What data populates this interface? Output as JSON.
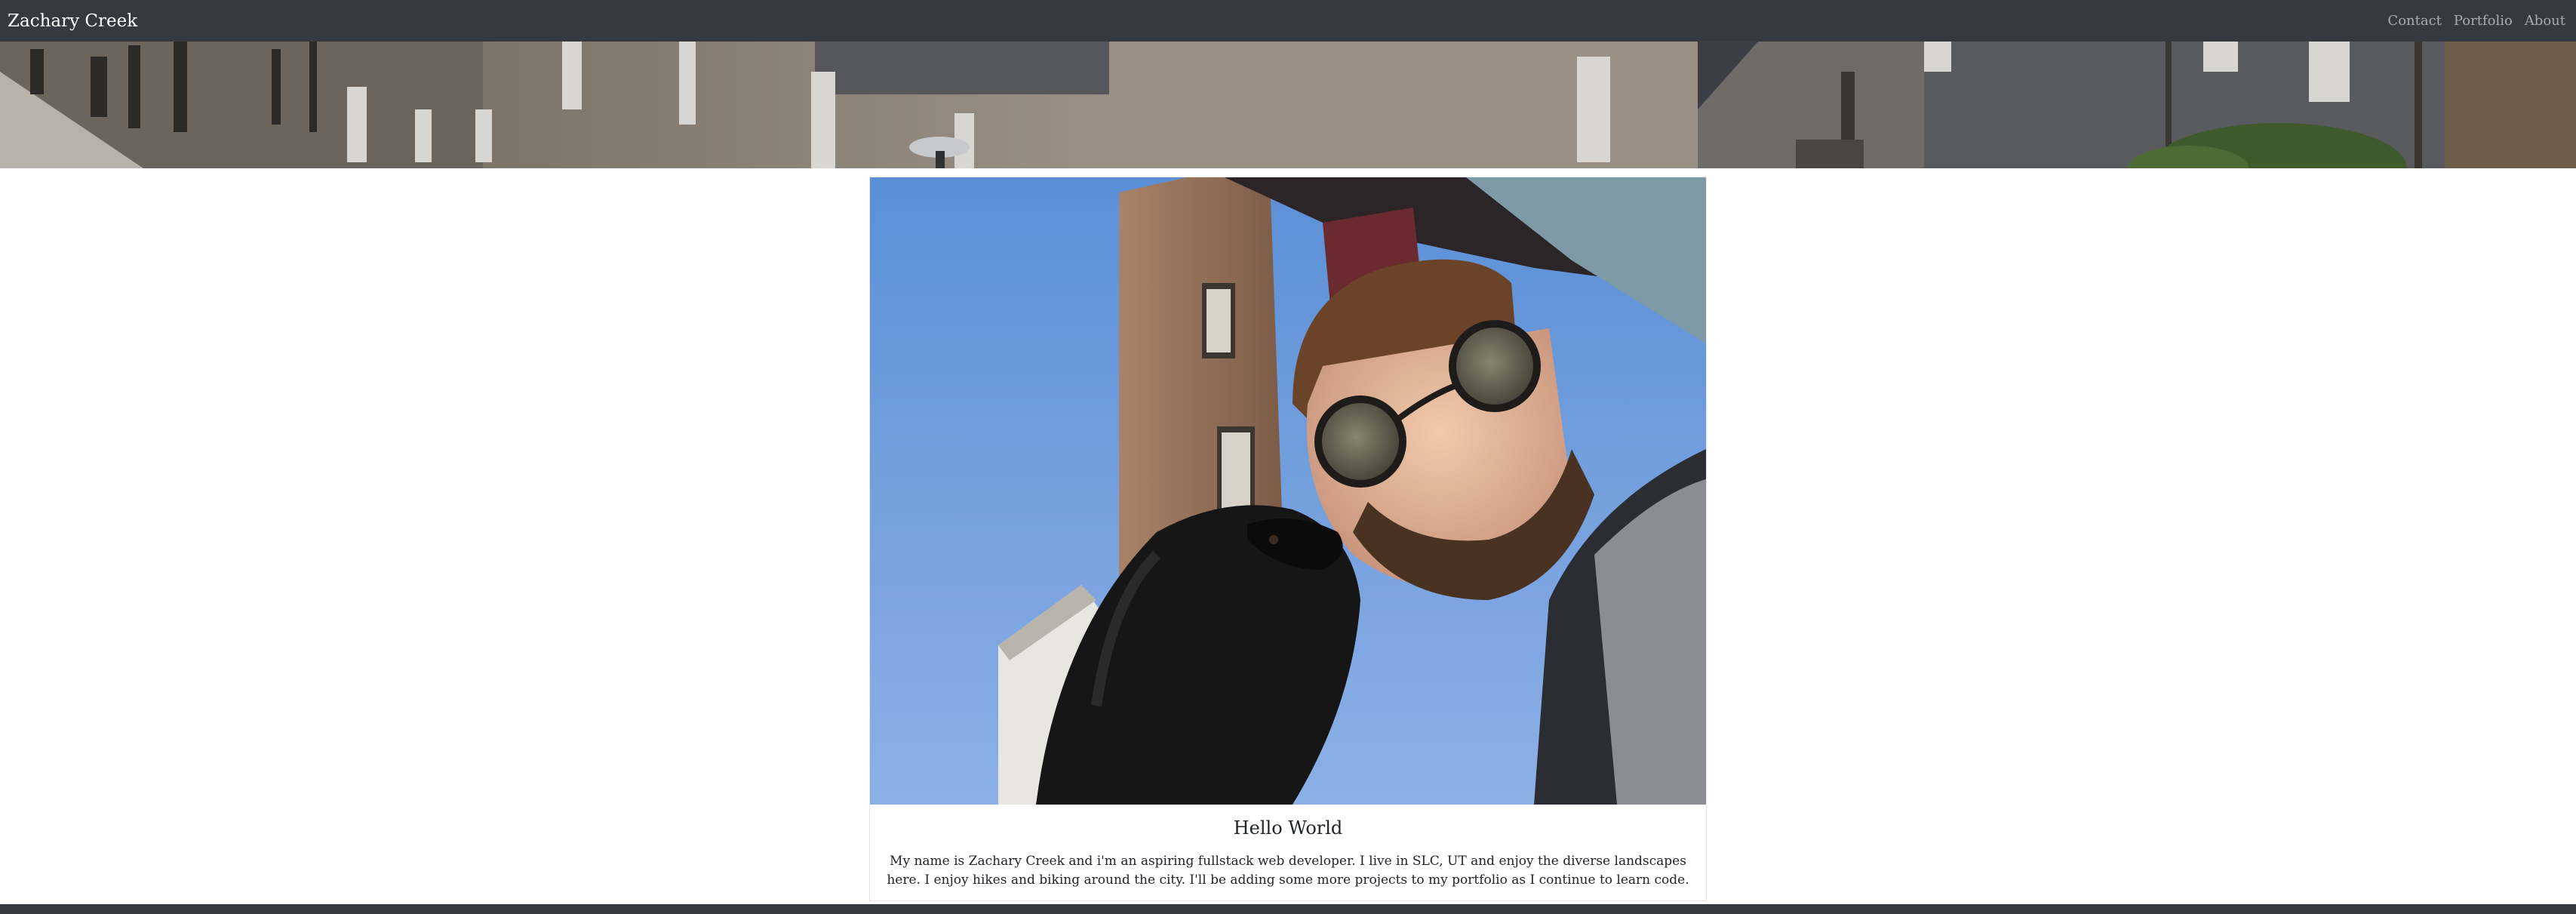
{
  "navbar": {
    "brand": "Zachary Creek",
    "links": [
      {
        "label": "Contact"
      },
      {
        "label": "Portfolio"
      },
      {
        "label": "About"
      }
    ]
  },
  "card": {
    "title": "Hello World",
    "text": "My name is Zachary Creek and i'm an aspiring fullstack web developer. I live in SLC, UT and enjoy the diverse landscapes here. I enjoy hikes and biking around the city. I'll be adding some more projects to my portfolio as I continue to learn code."
  },
  "colors": {
    "navbar_bg": "#343a40",
    "brand_text": "#ffffff",
    "nav_link": "#a7acb1",
    "body_text": "#212529"
  }
}
